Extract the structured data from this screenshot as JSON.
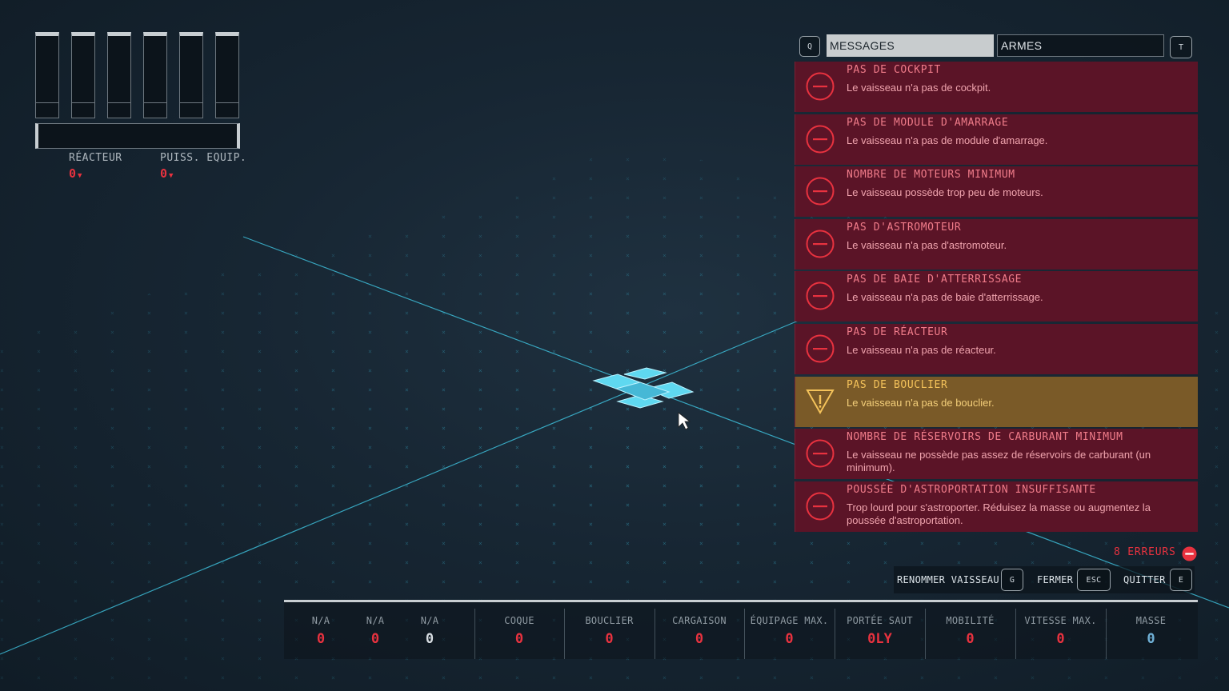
{
  "power": {
    "reactor_label": "RÉACTEUR",
    "reactor_value": "0",
    "equip_label": "PUISS. EQUIP.",
    "equip_value": "0"
  },
  "panel": {
    "left_key": "Q",
    "right_key": "T",
    "tabs": [
      {
        "label": "MESSAGES",
        "active": true
      },
      {
        "label": "ARMES",
        "active": false
      }
    ]
  },
  "messages": [
    {
      "title": "PAS DE COCKPIT",
      "desc": "Le vaisseau n'a pas de cockpit.",
      "severity": "error"
    },
    {
      "title": "PAS DE MODULE D'AMARRAGE",
      "desc": "Le vaisseau n'a pas de module d'amarrage.",
      "severity": "error"
    },
    {
      "title": "NOMBRE DE MOTEURS MINIMUM",
      "desc": "Le vaisseau possède trop peu de moteurs.",
      "severity": "error"
    },
    {
      "title": "PAS D'ASTROMOTEUR",
      "desc": "Le vaisseau n'a pas d'astromoteur.",
      "severity": "error"
    },
    {
      "title": "PAS DE BAIE D'ATTERRISSAGE",
      "desc": "Le vaisseau n'a pas de baie d'atterrissage.",
      "severity": "error"
    },
    {
      "title": "PAS DE RÉACTEUR",
      "desc": "Le vaisseau n'a pas de réacteur.",
      "severity": "error"
    },
    {
      "title": "PAS DE BOUCLIER",
      "desc": "Le vaisseau n'a pas de bouclier.",
      "severity": "warning"
    },
    {
      "title": "NOMBRE DE RÉSERVOIRS DE CARBURANT MINIMUM",
      "desc": "Le vaisseau ne possède pas assez de réservoirs de carburant (un minimum).",
      "severity": "error"
    },
    {
      "title": "POUSSÉE D'ASTROPORTATION INSUFFISANTE",
      "desc": "Trop lourd pour s'astroporter. Réduisez la masse ou augmentez la poussée d'astroportation.",
      "severity": "error"
    }
  ],
  "errors": {
    "label": "8 ERREURS"
  },
  "actions": [
    {
      "label": "RENOMMER VAISSEAU",
      "key": "G"
    },
    {
      "label": "FERMER",
      "key": "ESC"
    },
    {
      "label": "QUITTER",
      "key": "E"
    }
  ],
  "stats": [
    {
      "label": "N/A",
      "value": "0",
      "tone": "red"
    },
    {
      "label": "N/A",
      "value": "0",
      "tone": "red"
    },
    {
      "label": "N/A",
      "value": "0",
      "tone": "neutral"
    },
    {
      "label": "COQUE",
      "value": "0",
      "tone": "red"
    },
    {
      "label": "BOUCLIER",
      "value": "0",
      "tone": "red"
    },
    {
      "label": "CARGAISON",
      "value": "0",
      "tone": "red"
    },
    {
      "label": "ÉQUIPAGE MAX.",
      "value": "0",
      "tone": "red"
    },
    {
      "label": "PORTÉE SAUT",
      "value": "0LY",
      "tone": "red"
    },
    {
      "label": "MOBILITÉ",
      "value": "0",
      "tone": "red"
    },
    {
      "label": "VITESSE MAX.",
      "value": "0",
      "tone": "red"
    },
    {
      "label": "MASSE",
      "value": "0",
      "tone": "mass"
    }
  ],
  "colors": {
    "error_bg": "#5b1427",
    "warning_bg": "#7a5a28",
    "error_red": "#e8323f",
    "grid_cyan": "#3fc4e0"
  }
}
